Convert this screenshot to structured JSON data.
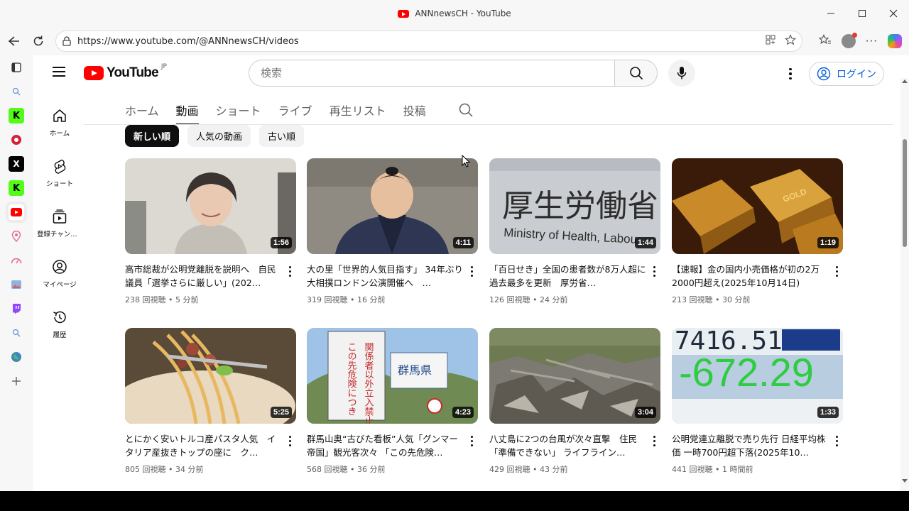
{
  "browser": {
    "title": "ANNnewsCH - YouTube",
    "url": "https://www.youtube.com/@ANNnewsCH/videos"
  },
  "masthead": {
    "logo_text": "YouTube",
    "country_code": "JP",
    "search_placeholder": "検索",
    "login_label": "ログイン"
  },
  "miniguide": [
    {
      "label": "ホーム",
      "icon": "home-icon"
    },
    {
      "label": "ショート",
      "icon": "shorts-icon"
    },
    {
      "label": "登録チャンネル",
      "icon": "subscriptions-icon"
    },
    {
      "label": "マイページ",
      "icon": "my-page-icon"
    },
    {
      "label": "履歴",
      "icon": "history-icon"
    }
  ],
  "tabs": [
    "ホーム",
    "動画",
    "ショート",
    "ライブ",
    "再生リスト",
    "投稿"
  ],
  "active_tab": "動画",
  "chips": [
    "新しい順",
    "人気の動画",
    "古い順"
  ],
  "videos": [
    {
      "title": "高市総裁が公明党離脱を説明へ　自民議員「選挙さらに厳しい」(202…",
      "views": "238 回視聴",
      "time": "5 分前",
      "duration": "1:56"
    },
    {
      "title": "大の里「世界的人気目指す」 34年ぶり大相撲ロンドン公演開催へ　…",
      "views": "319 回視聴",
      "time": "16 分前",
      "duration": "4:11"
    },
    {
      "title": "「百日せき」全国の患者数が8万人超に　過去最多を更新　厚労省…",
      "views": "126 回視聴",
      "time": "24 分前",
      "duration": "1:44"
    },
    {
      "title": "【速報】金の国内小売価格が初の2万2000円超え(2025年10月14日)",
      "views": "213 回視聴",
      "time": "30 分前",
      "duration": "1:19"
    },
    {
      "title": "とにかく安いトルコ産パスタ人気　イタリア産抜きトップの座に　ク…",
      "views": "805 回視聴",
      "time": "34 分前",
      "duration": "5:25"
    },
    {
      "title": "群馬山奥“古びた看板”人気「グンマー帝国」観光客次々 「この先危険…",
      "views": "568 回視聴",
      "time": "36 分前",
      "duration": "4:23"
    },
    {
      "title": "八丈島に2つの台風が次々直撃　住民「準備できない」 ライフライン…",
      "views": "429 回視聴",
      "time": "43 分前",
      "duration": "3:04"
    },
    {
      "title": "公明党連立離脱で売り先行 日経平均株価 一時700円超下落(2025年10…",
      "views": "441 回視聴",
      "time": "1 時間前",
      "duration": "1:33"
    }
  ],
  "thumb_text": {
    "v3_line1": "厚生労働省",
    "v3_line2": "Ministry of Health, Labou",
    "v4_bar": "GOLD",
    "v6_sign1": "この先危険につき",
    "v6_sign2": "関係者以外立入禁止",
    "v6_sign3": "群馬県",
    "v8_top": "7416.51",
    "v8_main": "-672.29"
  },
  "colors": {
    "brand_red": "#ff0000",
    "link_blue": "#065fd4",
    "text_primary": "#0f0f0f",
    "text_secondary": "#606060"
  }
}
